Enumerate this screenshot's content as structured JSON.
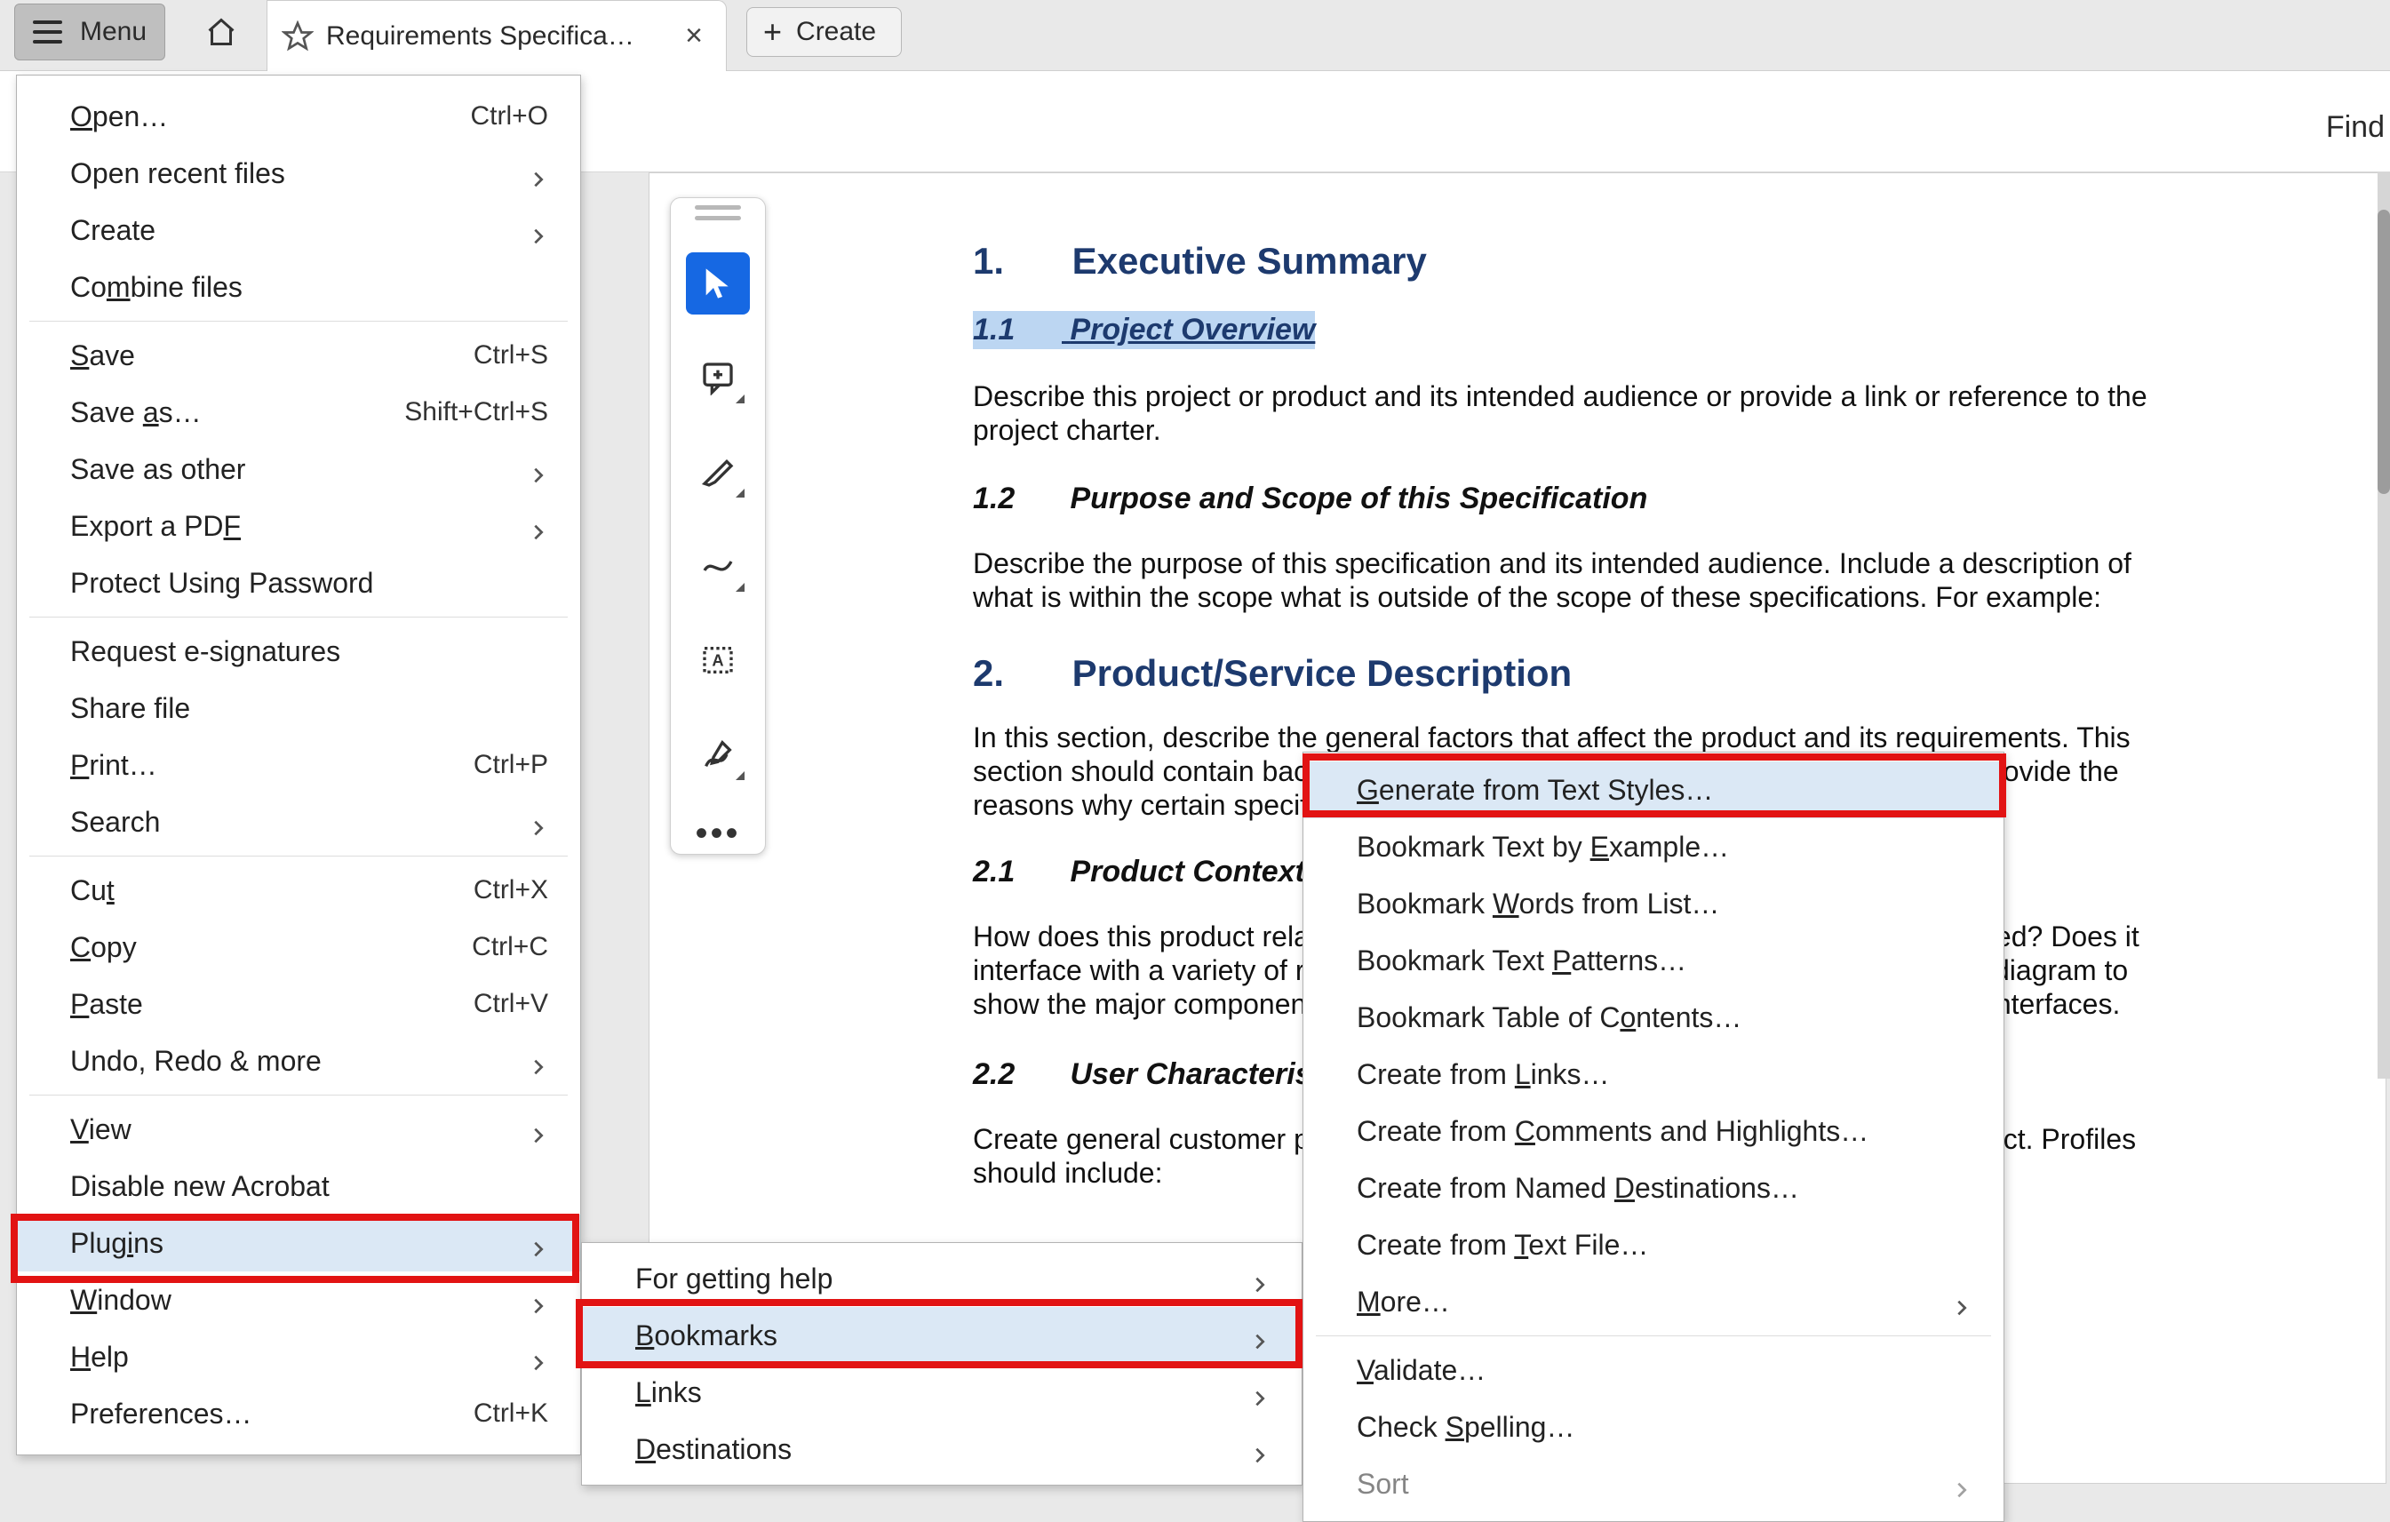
{
  "titlebar": {
    "menu_label": "Menu",
    "tab_label": "Requirements Specifica…",
    "close_glyph": "×",
    "create_label": "Create",
    "create_plus": "+"
  },
  "find": {
    "label": "Find"
  },
  "document": {
    "h1_1_num": "1.",
    "h1_1_text": "Executive Summary",
    "h11_num": "1.1",
    "h11_text": "Project Overview",
    "p11": "Describe this project or product and its intended audience or provide a link or reference to the project charter.",
    "h12_num": "1.2",
    "h12_text": "Purpose and Scope of this Specification",
    "p12": "Describe the purpose of this specification and its intended audience.   Include a description of what is within the scope what is outside of the scope of these specifications.  For example:",
    "h1_2_num": "2.",
    "h1_2_text": "Product/Service Description",
    "p2": "In this section, describe the general factors that affect the product and its requirements. This section should contain background information, not state specific requirements (provide the reasons why certain specific requirements are later specified).",
    "h21_num": "2.1",
    "h21_text": "Product Context",
    "p21": "How does this product relate to other products? Is it independent and self-contained?  Does it interface with a variety of related systems?  Describe these relationships or use a diagram to show the major components of the larger system, interconnections, and external interfaces.",
    "h22_num": "2.2",
    "h22_text": "User Characteristics",
    "p22": "Create general customer profiles for each type of user who will be using the product. Profiles should include:"
  },
  "menu": {
    "open": "Open…",
    "open_kbd": "Ctrl+O",
    "open_recent": "Open recent files",
    "create": "Create",
    "combine": "Combine files",
    "save": "Save",
    "save_kbd": "Ctrl+S",
    "save_as": "Save as…",
    "save_as_kbd": "Shift+Ctrl+S",
    "save_other": "Save as other",
    "export_pdf": "Export a PDF",
    "protect": "Protect Using Password",
    "esign": "Request e-signatures",
    "share": "Share file",
    "print": "Print…",
    "print_kbd": "Ctrl+P",
    "search": "Search",
    "cut": "Cut",
    "cut_kbd": "Ctrl+X",
    "copy": "Copy",
    "copy_kbd": "Ctrl+C",
    "paste": "Paste",
    "paste_kbd": "Ctrl+V",
    "undo": "Undo, Redo & more",
    "view": "View",
    "disable": "Disable new Acrobat",
    "plugins": "Plugins",
    "window": "Window",
    "help": "Help",
    "preferences": "Preferences…",
    "preferences_kbd": "Ctrl+K"
  },
  "plugins_menu": {
    "help": "For getting help",
    "bookmarks": "Bookmarks",
    "links": "Links",
    "destinations": "Destinations"
  },
  "bookmarks_menu": {
    "generate": "Generate from Text Styles…",
    "by_example": "Bookmark Text by Example…",
    "words_list": "Bookmark Words from List…",
    "text_patterns": "Bookmark Text Patterns…",
    "toc": "Bookmark Table of Contents…",
    "from_links": "Create from Links…",
    "from_comments": "Create from Comments and Highlights…",
    "from_named": "Create from Named Destinations…",
    "from_textfile": "Create from Text File…",
    "more": "More…",
    "validate": "Validate…",
    "spelling": "Check Spelling…",
    "sort": "Sort"
  }
}
